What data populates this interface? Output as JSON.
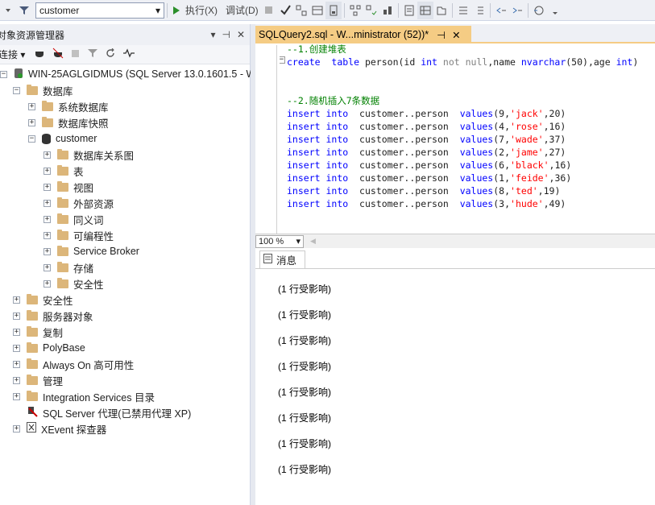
{
  "toolbar": {
    "database": "customer",
    "execute_label": "执行(X)",
    "debug_label": "调试(D)"
  },
  "object_explorer": {
    "title": "对象资源管理器",
    "connect_label": "连接",
    "server": "WIN-25AGLGIDMUS (SQL Server 13.0.1601.5 - W",
    "nodes": [
      "数据库",
      "系统数据库",
      "数据库快照",
      "customer",
      "数据库关系图",
      "表",
      "视图",
      "外部资源",
      "同义词",
      "可编程性",
      "Service Broker",
      "存储",
      "安全性",
      "安全性",
      "服务器对象",
      "复制",
      "PolyBase",
      "Always On 高可用性",
      "管理",
      "Integration Services 目录",
      "SQL Server 代理(已禁用代理 XP)",
      "XEvent 探查器"
    ]
  },
  "editor": {
    "tab_title": "SQLQuery2.sql - W...ministrator (52))*",
    "zoom": "100 %",
    "lines": {
      "c1": "--1.创建堆表",
      "l2a": "create",
      "l2b": "table",
      "l2c": " person(id ",
      "l2d": "int",
      "l2e": "not null",
      "l2f": ",name ",
      "l2g": "nvarchar",
      "l2h": "(50),age ",
      "l2i": "int",
      "l2j": ")",
      "c2": "--2.随机插入7条数据"
    },
    "inserts": [
      {
        "id": "9",
        "name": "'jack'",
        "age": "20"
      },
      {
        "id": "4",
        "name": "'rose'",
        "age": "16"
      },
      {
        "id": "7",
        "name": "'wade'",
        "age": "37"
      },
      {
        "id": "2",
        "name": "'jame'",
        "age": "27"
      },
      {
        "id": "6",
        "name": "'black'",
        "age": "16"
      },
      {
        "id": "1",
        "name": "'feide'",
        "age": "36"
      },
      {
        "id": "8",
        "name": "'ted'",
        "age": "19"
      },
      {
        "id": "3",
        "name": "'hude'",
        "age": "49"
      }
    ],
    "insert_kw": "insert",
    "into_kw": "into",
    "table_name": "customer..person",
    "values_kw": "values"
  },
  "results": {
    "tab_label": "消息",
    "messages": [
      "(1 行受影响)",
      "(1 行受影响)",
      "(1 行受影响)",
      "(1 行受影响)",
      "(1 行受影响)",
      "(1 行受影响)",
      "(1 行受影响)",
      "(1 行受影响)"
    ]
  }
}
